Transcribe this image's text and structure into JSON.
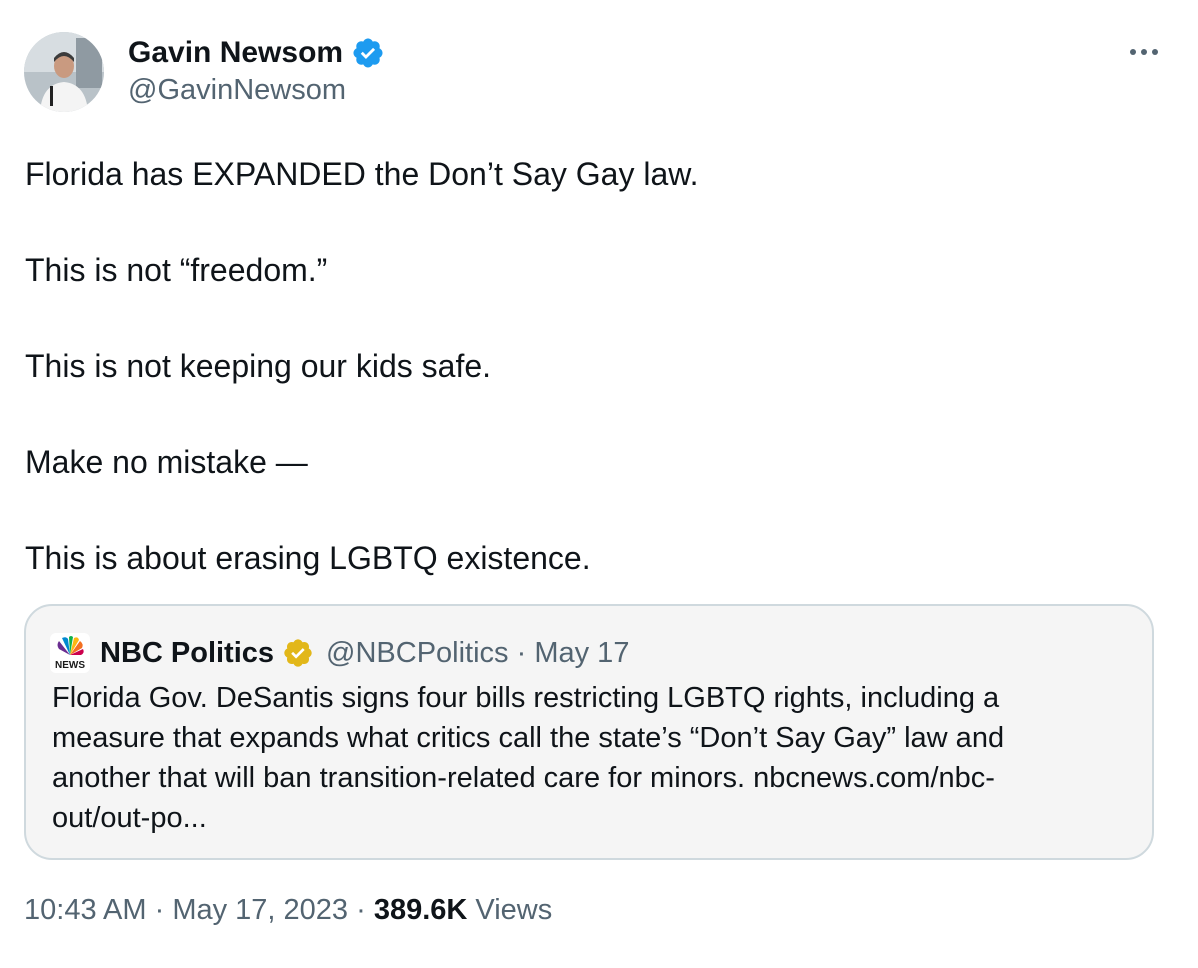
{
  "author": {
    "name": "Gavin Newsom",
    "handle": "@GavinNewsom",
    "verified_color": "#1d9bf0"
  },
  "tweet": {
    "lines": [
      "Florida has EXPANDED the Don’t Say Gay law.",
      "This is not “freedom.”",
      "This is not keeping our kids safe.",
      "Make no mistake —",
      "This is about erasing LGBTQ existence."
    ]
  },
  "quoted": {
    "name": "NBC Politics",
    "handle": "@NBCPolitics",
    "separator": " · ",
    "date": "May 17",
    "badge_color": "#e2b719",
    "text_lines": [
      "Florida Gov. DeSantis signs four bills restricting LGBTQ rights, including a",
      "measure that expands what critics call the state’s “Don’t Say Gay” law and",
      "another that will ban transition-related care for minors. nbcnews.com/nbc-",
      "out/out-po..."
    ]
  },
  "footer": {
    "time": "10:43 AM",
    "date": "May 17, 2023",
    "sep": " · ",
    "views_count": "389.6K",
    "views_label": " Views"
  },
  "colors": {
    "text": "#0f1419",
    "secondary": "#536471",
    "border": "#cfd9de",
    "quote_bg": "#f5f5f5"
  }
}
